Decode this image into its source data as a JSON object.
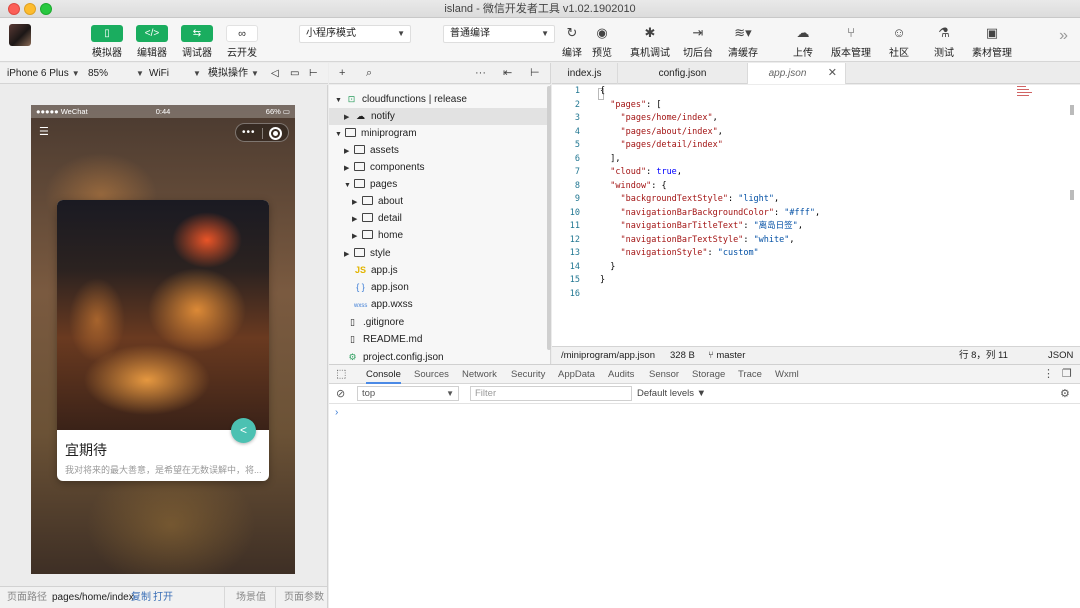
{
  "window": {
    "title": "island - 微信开发者工具 v1.02.1902010"
  },
  "toolbar": {
    "simulator": "模拟器",
    "editor": "编辑器",
    "debugger": "调试器",
    "cloud": "云开发",
    "mode_select": "小程序模式",
    "compile_select": "普通编译",
    "compile": "编译",
    "preview": "预览",
    "remote_debug": "真机调试",
    "background": "切后台",
    "clear_cache": "清缓存",
    "upload": "上传",
    "version": "版本管理",
    "community": "社区",
    "test": "测试",
    "assets": "素材管理",
    "more": "»"
  },
  "simbar": {
    "device": "iPhone 6 Plus",
    "zoom": "85%",
    "network": "WiFi",
    "operate": "模拟操作"
  },
  "phone": {
    "carrier": "●●●●● WeChat",
    "time": "0:44",
    "battery": "66%",
    "card_title": "宜期待",
    "card_desc": "我对将来的最大善意，是希望在无数误解中，将..."
  },
  "bottombar": {
    "path_label": "页面路径",
    "path": "pages/home/index",
    "copy": "复制",
    "open": "打开",
    "scene": "场景值",
    "params": "页面参数"
  },
  "tree": {
    "items": [
      {
        "label": "cloudfunctions | release"
      },
      {
        "label": "notify"
      },
      {
        "label": "miniprogram"
      },
      {
        "label": "assets"
      },
      {
        "label": "components"
      },
      {
        "label": "pages"
      },
      {
        "label": "about"
      },
      {
        "label": "detail"
      },
      {
        "label": "home"
      },
      {
        "label": "style"
      },
      {
        "label": "app.js",
        "icon": "JS"
      },
      {
        "label": "app.json",
        "icon": "{ }"
      },
      {
        "label": "app.wxss",
        "icon": "wxss"
      },
      {
        "label": ".gitignore"
      },
      {
        "label": "README.md"
      },
      {
        "label": "project.config.json"
      }
    ]
  },
  "tabs": [
    "index.js",
    "config.json",
    "app.json"
  ],
  "editor": {
    "lines": [
      "1",
      "2",
      "3",
      "4",
      "5",
      "6",
      "7",
      "8",
      "9",
      "10",
      "11",
      "12",
      "13",
      "14",
      "15",
      "16"
    ]
  },
  "statusline": {
    "path": "/miniprogram/app.json",
    "size": "328 B",
    "branch": "master",
    "cursor": "行 8，列 11",
    "lang": "JSON"
  },
  "devtools": {
    "tabs": [
      "Console",
      "Sources",
      "Network",
      "Security",
      "AppData",
      "Audits",
      "Sensor",
      "Storage",
      "Trace",
      "Wxml"
    ],
    "context": "top",
    "filter_placeholder": "Filter",
    "levels": "Default levels ▼",
    "prompt": "›"
  },
  "colors": {
    "accent_green": "#1aad5f",
    "share_teal": "#4cc1b2",
    "tab_blue": "#4b8ae6"
  }
}
